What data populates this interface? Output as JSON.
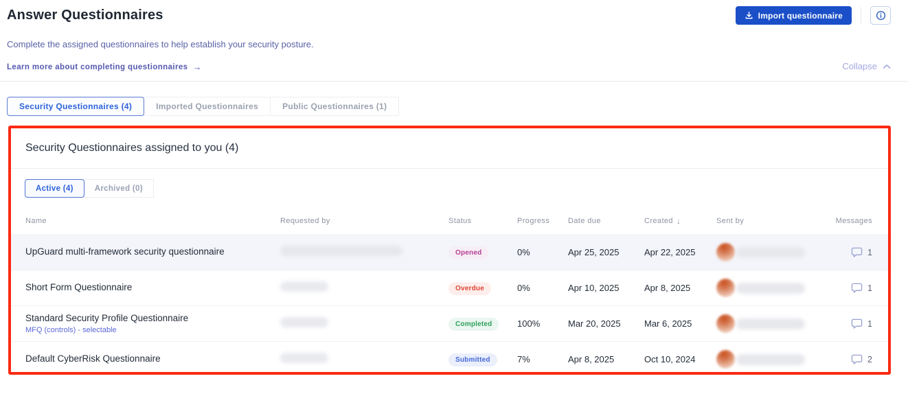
{
  "page": {
    "title": "Answer Questionnaires",
    "subtitle": "Complete the assigned questionnaires to help establish your security posture.",
    "learn_more_label": "Learn more about completing questionnaires",
    "collapse_label": "Collapse",
    "import_button_label": "Import questionnaire"
  },
  "tabs": [
    {
      "label": "Security Questionnaires (4)",
      "active": true
    },
    {
      "label": "Imported Questionnaires",
      "active": false
    },
    {
      "label": "Public Questionnaires (1)",
      "active": false
    }
  ],
  "panel": {
    "title": "Security Questionnaires assigned to you (4)",
    "subtabs": [
      {
        "label": "Active (4)",
        "active": true
      },
      {
        "label": "Archived (0)",
        "active": false
      }
    ],
    "columns": {
      "name": "Name",
      "requested_by": "Requested by",
      "status": "Status",
      "progress": "Progress",
      "date_due": "Date due",
      "created": "Created",
      "sent_by": "Sent by",
      "messages": "Messages"
    },
    "sorted_by": "Created",
    "sort_direction": "desc",
    "rows": [
      {
        "name": "UpGuard multi-framework security questionnaire",
        "subtitle": "",
        "status": "Opened",
        "status_type": "opened",
        "progress": "0%",
        "date_due": "Apr 25, 2025",
        "created": "Apr 22, 2025",
        "messages": "1",
        "highlighted": true,
        "requested_redaction": "wide"
      },
      {
        "name": "Short Form Questionnaire",
        "subtitle": "",
        "status": "Overdue",
        "status_type": "overdue",
        "progress": "0%",
        "date_due": "Apr 10, 2025",
        "created": "Apr 8, 2025",
        "messages": "1",
        "highlighted": false,
        "requested_redaction": "narrow"
      },
      {
        "name": "Standard Security Profile Questionnaire",
        "subtitle": "MFQ (controls) - selectable",
        "status": "Completed",
        "status_type": "completed",
        "progress": "100%",
        "date_due": "Mar 20, 2025",
        "created": "Mar 6, 2025",
        "messages": "1",
        "highlighted": false,
        "requested_redaction": "narrow"
      },
      {
        "name": "Default CyberRisk Questionnaire",
        "subtitle": "",
        "status": "Submitted",
        "status_type": "submitted",
        "progress": "7%",
        "date_due": "Apr 8, 2025",
        "created": "Oct 10, 2024",
        "messages": "2",
        "highlighted": false,
        "requested_redaction": "narrow"
      }
    ]
  },
  "colors": {
    "accent_blue": "#1a4fc8",
    "highlight_border_red": "#fb2a12",
    "status_opened": "#b53f94",
    "status_overdue": "#e04433",
    "status_completed": "#2fa05e",
    "status_submitted": "#4468d9",
    "link_purple": "#5558b0"
  }
}
